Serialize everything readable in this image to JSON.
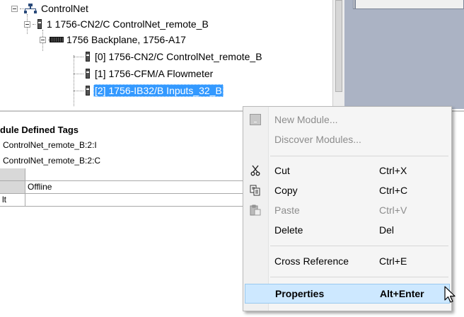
{
  "tree": {
    "nodes": [
      {
        "label": "ControlNet"
      },
      {
        "label": "1 1756-CN2/C ControlNet_remote_B"
      },
      {
        "label": "1756 Backplane, 1756-A17"
      },
      {
        "label": "[0] 1756-CN2/C ControlNet_remote_B"
      },
      {
        "label": "[1] 1756-CFM/A Flowmeter"
      },
      {
        "label": "[2] 1756-IB32/B Inputs_32_B"
      }
    ]
  },
  "tags": {
    "header": "dule Defined Tags",
    "lines": [
      "ControlNet_remote_B:2:I",
      "ControlNet_remote_B:2:C"
    ],
    "grid_status": "Offline",
    "grid_row_label": "lt"
  },
  "context_menu": {
    "items": [
      {
        "label": "New Module...",
        "shortcut": "",
        "icon": "new-module-icon",
        "disabled": true
      },
      {
        "label": "Discover Modules...",
        "shortcut": "",
        "icon": "",
        "disabled": true
      },
      {
        "label": "Cut",
        "shortcut": "Ctrl+X",
        "icon": "scissors-icon",
        "disabled": false
      },
      {
        "label": "Copy",
        "shortcut": "Ctrl+C",
        "icon": "copy-icon",
        "disabled": false
      },
      {
        "label": "Paste",
        "shortcut": "Ctrl+V",
        "icon": "paste-icon",
        "disabled": true
      },
      {
        "label": "Delete",
        "shortcut": "Del",
        "icon": "",
        "disabled": false
      },
      {
        "label": "Cross Reference",
        "shortcut": "Ctrl+E",
        "icon": "",
        "disabled": false
      },
      {
        "label": "Properties",
        "shortcut": "Alt+Enter",
        "icon": "",
        "disabled": false,
        "highlighted": true
      }
    ]
  },
  "colors": {
    "selection": "#3399ff",
    "menu_highlight": "#cde8ff",
    "side_pane": "#abb3c4"
  }
}
